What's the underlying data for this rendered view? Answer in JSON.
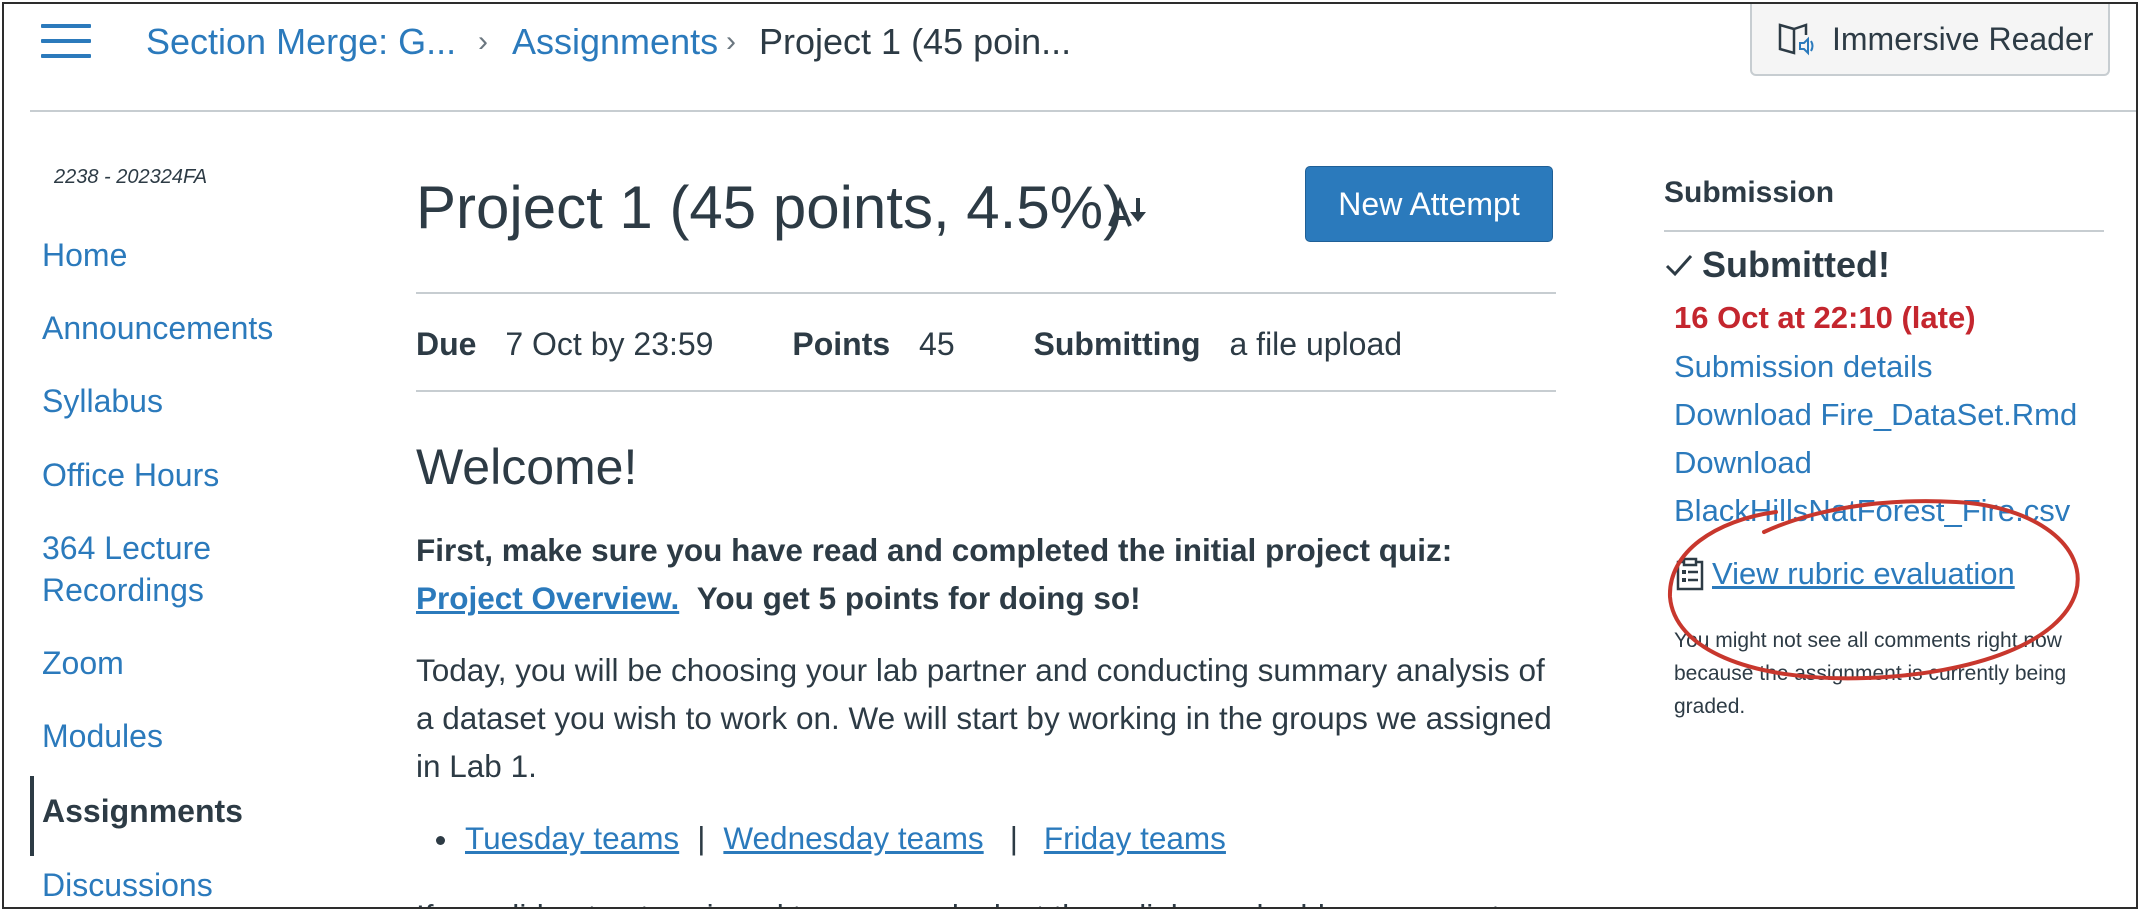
{
  "header": {
    "menu_icon": "hamburger-menu-icon",
    "breadcrumbs": [
      {
        "label": "Section Merge: G..."
      },
      {
        "label": "Assignments"
      },
      {
        "label": "Project 1 (45 poin..."
      }
    ],
    "immersive_reader": {
      "label": "Immersive Reader",
      "icon": "immersive-reader-icon"
    }
  },
  "sidebar": {
    "course_code": "2238 - 202324FA",
    "items": [
      {
        "label": "Home"
      },
      {
        "label": "Announcements"
      },
      {
        "label": "Syllabus"
      },
      {
        "label": "Office Hours"
      },
      {
        "label": "364 Lecture Recordings"
      },
      {
        "label": "Zoom"
      },
      {
        "label": "Modules"
      },
      {
        "label": "Assignments",
        "active": true
      },
      {
        "label": "Discussions"
      }
    ]
  },
  "main": {
    "title": "Project 1 (45 points, 4.5%)",
    "new_attempt_label": "New Attempt",
    "details": {
      "due_label": "Due",
      "due_value": "7 Oct by 23:59",
      "points_label": "Points",
      "points_value": "45",
      "submitting_label": "Submitting",
      "submitting_value": "a file upload"
    },
    "welcome": "Welcome!",
    "intro_bold": "First, make sure you have read and completed the initial project quiz:",
    "intro_link": "Project Overview.",
    "intro_tail": "You get 5 points for doing so!",
    "paragraph": "Today, you will be choosing your lab partner and conducting summary analysis of a dataset you wish to work on.  We will start by working in the groups we assigned in Lab 1.",
    "teams": [
      "Tuesday teams",
      "Wednesday teams",
      "Friday teams"
    ],
    "team_separator": "|",
    "cut_text": "If you did not get assigned to a group, look at these links and add your name to"
  },
  "submission": {
    "heading": "Submission",
    "status": "Submitted!",
    "date": "16 Oct at 22:10 (late)",
    "links": [
      "Submission details",
      "Download Fire_DataSet.Rmd",
      "Download",
      "BlackHillsNatForest_Fire.csv"
    ],
    "rubric_label": "View rubric evaluation",
    "note": "You might not see all comments right now because the assignment is currently being graded."
  },
  "colors": {
    "link": "#2b7abc",
    "text": "#2d3b45",
    "late": "#c4262e",
    "annotation": "#c8372d",
    "button": "#2b7abc"
  }
}
